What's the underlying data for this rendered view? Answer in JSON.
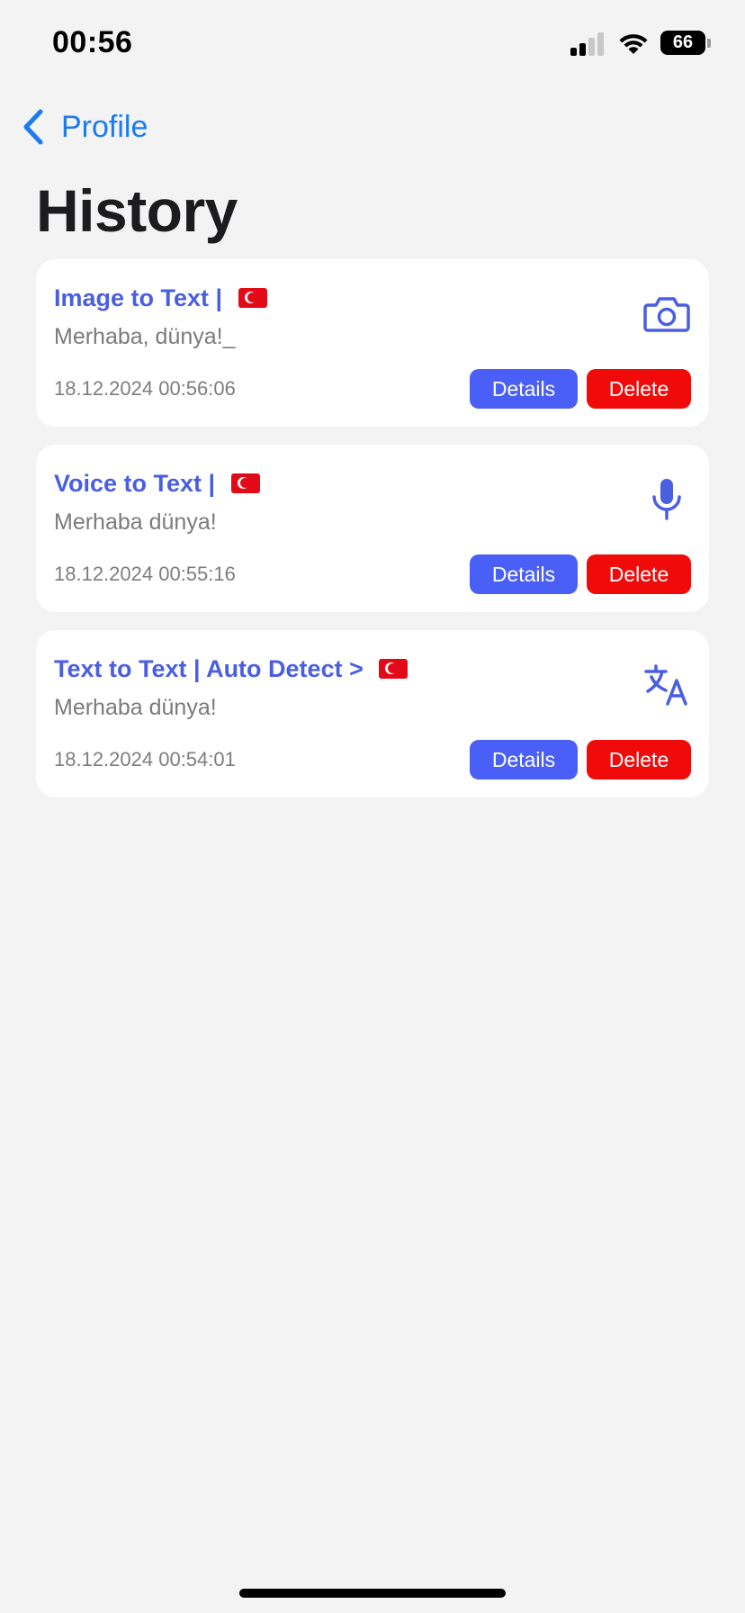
{
  "status_bar": {
    "time": "00:56",
    "battery": "66"
  },
  "nav": {
    "back_label": "Profile"
  },
  "page": {
    "title": "History"
  },
  "accent_color": "#4a5fe0",
  "history": [
    {
      "title": "Image to Text | ",
      "flag": "Turkey flag",
      "text": "Merhaba, dünya!_",
      "date": "18.12.2024 00:56:06",
      "icon": "camera-icon",
      "details_label": "Details",
      "delete_label": "Delete"
    },
    {
      "title": "Voice to Text | ",
      "flag": "Turkey flag",
      "text": "Merhaba dünya!",
      "date": "18.12.2024 00:55:16",
      "icon": "microphone-icon",
      "details_label": "Details",
      "delete_label": "Delete"
    },
    {
      "title": "Text to Text | Auto Detect > ",
      "flag": "Turkey flag",
      "text": "Merhaba dünya!",
      "date": "18.12.2024 00:54:01",
      "icon": "translate-icon",
      "details_label": "Details",
      "delete_label": "Delete"
    }
  ]
}
